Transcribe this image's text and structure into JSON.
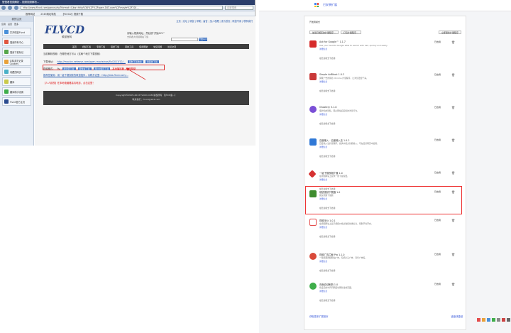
{
  "browser": {
    "title": "慢慢看视频解析 - 视频视频解析...",
    "url": "http://www.flvcd.com/parse.php?format=&kw=http%3A%2F%2Fopen.163.com%2Fmovie%2F201...",
    "search_placeholder": "百度搜索",
    "fav_items": [
      "推荐网站",
      "2345网址导航",
      "【FLVCD】视频下载"
    ]
  },
  "sidebar": {
    "title": "我的主页",
    "tabs": [
      "应用",
      "设置",
      "更多"
    ],
    "items": [
      "打开硕鼠Flvcd",
      "搜索所有中心",
      "搜索下载标记",
      "清除浏览记录Cookies",
      "收藏的网页",
      "翻译",
      "翻译助手设置",
      "Flvcd官方主页"
    ]
  },
  "site": {
    "logo": "FLVCD",
    "logo_sub": "硕鼠官网",
    "top_links": "主页 | 论坛 | 硕鼠 | 帮助 | 留言 | 加入收藏 | 设为首页 | 硕鼠专用 | 联系我们",
    "slogan": "请输入视频地址，然后按“开始GO!”",
    "slogan_sub": "支持各大视频网站下载",
    "search_button": "开始GO!",
    "menu": [
      "首页",
      "视频下载",
      "专辑下载",
      "硕鼠下载",
      "转换工具",
      "使用帮助",
      "常见问题",
      "论坛交流"
    ],
    "breadcrumb": "当前解析视频：在哪些地方可以（这两个地方下载视频）",
    "line1_label": "下载地址：",
    "line1_link": "http://mov.bn.netease.com/open-movie/nos/flv/2013/12/...",
    "line1_btns": [
      "复制下载地址",
      "用硕鼠下载"
    ],
    "line2_label": "视频格式：",
    "line2_value": "flv",
    "line2_btns": [
      "用迅雷下载",
      "用快车下载",
      "用QQ旋风下载"
    ],
    "line2_red": "本地播放器 - 使用帮助",
    "line3": "推荐您使用：用一键下载视频的硕鼠插件，请移步这里：http://bbs.flvcd.com/...",
    "line4": "【人人影视】在本地电脑看高清电影，点击这里！",
    "footer_line1": "Copyright©2005-2013 FLVCD.COM 版权所有 【沪ICP备...】",
    "footer_line2": "联系我们：Flvcd@163.com"
  },
  "extensions_page": {
    "title": "已安装扩展",
    "dev_mode_label": "开发者模式",
    "dev_buttons": [
      "加载已解压的扩展程序...",
      "打包扩展程序...",
      "立即更新扩展程序"
    ],
    "enabled_label": "已启用",
    "view_details": "详细信息",
    "options_link": "选项",
    "allow_incognito": "在隐身模式下启用",
    "get_more": "获取更多扩展程序",
    "shortcuts": "键盘快捷键",
    "items": [
      {
        "name": "Ask for Google™",
        "version": "1.1.7",
        "desc": "Use your favorite Google sites to search with Ask, quickly and easily.",
        "color": "#d62b2b"
      },
      {
        "name": "Simple AdBlock",
        "version": "1.0.2",
        "desc": "屏蔽广告的简易 Chrome 扩展程序，让浏览更加干净。",
        "color": "#c93838"
      },
      {
        "name": "Ghostery",
        "version": "5.1.0",
        "desc": "保护您的隐私，阻止网站追踪您的浏览行为。",
        "color": "#7a4fd6"
      },
      {
        "name": "百度输入 - 百度输入法",
        "version": "1.0.2",
        "desc": "百度输入法扩展程序，提供中英文智能输入，可在任意网页中使用。",
        "color": "#2f78d6"
      },
      {
        "name": "一键下载视频扩展",
        "version": "1.0",
        "desc": "在视频网站上提供一键下载按钮。",
        "color": "#d63232"
      },
      {
        "name": "硕鼠视频下载器",
        "version": "1.0",
        "desc": "硕鼠视频下载器",
        "color": "#3e8c2f"
      },
      {
        "name": "视频半价",
        "version": "1.0.1",
        "desc": "在视频网站上显示视频价格比较和优惠信息，帮助节省开支。",
        "color": "#e34c4c"
      },
      {
        "name": "视频广告拦截 Pro",
        "version": "1.1.0",
        "desc": "一键屏蔽视频网站广告，包括片头广告、暂停广告等。",
        "color": "#d94a3a"
      },
      {
        "name": "页面自动刷新",
        "version": "1.0",
        "desc": "按设定的时间间隔自动刷新当前页面。",
        "color": "#3fae4a"
      }
    ]
  }
}
